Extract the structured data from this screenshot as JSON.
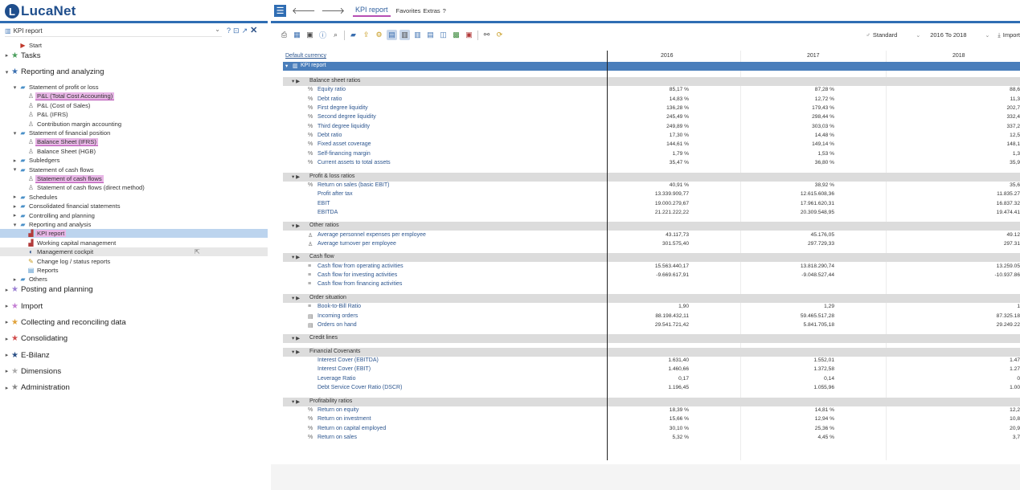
{
  "app": {
    "logo_text": "LucaNet"
  },
  "left": {
    "search_value": "KPI report",
    "tools": {
      "help": "?",
      "filter": "⊡",
      "pin": "↗",
      "close": "✕"
    },
    "tree": [
      {
        "label": "Start",
        "level": 1,
        "icon": "flag",
        "big": false
      },
      {
        "label": "Tasks",
        "level": 0,
        "icon": "star",
        "big": true
      },
      {
        "label": "Reporting and analyzing",
        "level": 0,
        "icon": "star",
        "big": true
      },
      {
        "label": "Statement of profit or loss",
        "level": 1,
        "icon": "folder"
      },
      {
        "label": "P&L (Total Cost Accounting)",
        "level": 2,
        "icon": "doc",
        "highlight": true
      },
      {
        "label": "P&L (Cost of Sales)",
        "level": 2,
        "icon": "doc"
      },
      {
        "label": "P&L (IFRS)",
        "level": 2,
        "icon": "doc"
      },
      {
        "label": "Contribution margin accounting",
        "level": 2,
        "icon": "doc"
      },
      {
        "label": "Statement of financial position",
        "level": 1,
        "icon": "folder"
      },
      {
        "label": "Balance Sheet (IFRS)",
        "level": 2,
        "icon": "doc",
        "highlight": true
      },
      {
        "label": "Balance Sheet (HGB)",
        "level": 2,
        "icon": "doc"
      },
      {
        "label": "Subledgers",
        "level": 1,
        "icon": "folder"
      },
      {
        "label": "Statement of cash flows",
        "level": 1,
        "icon": "folder"
      },
      {
        "label": "Statement of cash flows",
        "level": 2,
        "icon": "doc",
        "highlight": true
      },
      {
        "label": "Statement of cash flows (direct method)",
        "level": 2,
        "icon": "doc"
      },
      {
        "label": "Schedules",
        "level": 1,
        "icon": "folder"
      },
      {
        "label": "Consolidated financial statements",
        "level": 1,
        "icon": "folder"
      },
      {
        "label": "Controlling and planning",
        "level": 1,
        "icon": "folder"
      },
      {
        "label": "Reporting and analysis",
        "level": 1,
        "icon": "folder"
      },
      {
        "label": "KPI report",
        "level": 2,
        "icon": "chart",
        "highlight": true,
        "selected": true
      },
      {
        "label": "Working capital management",
        "level": 2,
        "icon": "chart"
      },
      {
        "label": "Management cockpit",
        "level": 2,
        "icon": "gauge",
        "hover": true
      },
      {
        "label": "Change log / status reports",
        "level": 2,
        "icon": "log"
      },
      {
        "label": "Reports",
        "level": 2,
        "icon": "report"
      },
      {
        "label": "Others",
        "level": 1,
        "icon": "folder"
      },
      {
        "label": "Posting and planning",
        "level": 0,
        "icon": "star",
        "big": true
      },
      {
        "label": "Import",
        "level": 0,
        "icon": "star",
        "big": true
      },
      {
        "label": "Collecting and reconciling data",
        "level": 0,
        "icon": "star",
        "big": true
      },
      {
        "label": "Consolidating",
        "level": 0,
        "icon": "star",
        "big": true
      },
      {
        "label": "E-Bilanz",
        "level": 0,
        "icon": "star",
        "big": true
      },
      {
        "label": "Dimensions",
        "level": 0,
        "icon": "star",
        "big": true
      },
      {
        "label": "Administration",
        "level": 0,
        "icon": "star",
        "big": true
      }
    ]
  },
  "topnav": {
    "tab_label": "KPI report",
    "links": [
      "Favorites",
      "Extras",
      "?"
    ]
  },
  "toolbar_right": {
    "view": "Standard",
    "period": "2016 To 2018",
    "import": "Import"
  },
  "grid": {
    "header_left": "Default currency",
    "columns": [
      "2016",
      "2017",
      "2018"
    ],
    "report_title": "KPI report",
    "rows": [
      {
        "type": "group",
        "label": "Balance sheet ratios"
      },
      {
        "type": "item",
        "icon": "%",
        "label": "Equity ratio",
        "values": [
          "85,17 %",
          "87,28 %",
          "88,6"
        ]
      },
      {
        "type": "item",
        "icon": "%",
        "label": "Debt ratio",
        "values": [
          "14,83 %",
          "12,72 %",
          "11,3"
        ]
      },
      {
        "type": "item",
        "icon": "%",
        "label": "First degree liquidity",
        "values": [
          "136,28 %",
          "179,43 %",
          "202,7"
        ]
      },
      {
        "type": "item",
        "icon": "%",
        "label": "Second degree liquidity",
        "values": [
          "245,49 %",
          "298,44 %",
          "332,4"
        ]
      },
      {
        "type": "item",
        "icon": "%",
        "label": "Third degree liquidity",
        "values": [
          "249,89 %",
          "303,03 %",
          "337,2"
        ]
      },
      {
        "type": "item",
        "icon": "%",
        "label": "Debt ratio",
        "values": [
          "17,30 %",
          "14,48 %",
          "12,5"
        ]
      },
      {
        "type": "item",
        "icon": "%",
        "label": "Fixed asset coverage",
        "values": [
          "144,61 %",
          "149,14 %",
          "148,1"
        ]
      },
      {
        "type": "item",
        "icon": "%",
        "label": "Self-financing margin",
        "values": [
          "1,79 %",
          "1,53 %",
          "1,3"
        ]
      },
      {
        "type": "item",
        "icon": "%",
        "label": "Current assets to total assets",
        "values": [
          "35,47 %",
          "36,80 %",
          "35,9"
        ]
      },
      {
        "type": "gap"
      },
      {
        "type": "group",
        "label": "Profit & loss ratios"
      },
      {
        "type": "item",
        "icon": "%",
        "label": "Return on sales (basic EBIT)",
        "values": [
          "40,91 %",
          "38,92 %",
          "35,6"
        ]
      },
      {
        "type": "item",
        "icon": "",
        "label": "Profit after tax",
        "values": [
          "13.339.909,77",
          "12.615.608,36",
          "11.835.27"
        ]
      },
      {
        "type": "item",
        "icon": "",
        "label": "EBIT",
        "values": [
          "19.000.279,67",
          "17.961.620,31",
          "16.837.32"
        ]
      },
      {
        "type": "item",
        "icon": "",
        "label": "EBITDA",
        "values": [
          "21.221.222,22",
          "20.309.548,95",
          "19.474.41"
        ]
      },
      {
        "type": "gap"
      },
      {
        "type": "group",
        "label": "Other ratios"
      },
      {
        "type": "item",
        "icon": "♙",
        "label": "Average personnel expenses per employee",
        "values": [
          "43.117,73",
          "45.176,05",
          "49.12"
        ]
      },
      {
        "type": "item",
        "icon": "♙",
        "label": "Average turnover per employee",
        "values": [
          "301.575,40",
          "297.729,33",
          "297.31"
        ]
      },
      {
        "type": "gap"
      },
      {
        "type": "group",
        "label": "Cash flow"
      },
      {
        "type": "item",
        "icon": "≡",
        "label": "Cash flow from operating activities",
        "values": [
          "15.563.440,17",
          "13.818.290,74",
          "13.259.05"
        ]
      },
      {
        "type": "item",
        "icon": "≡",
        "label": "Cash flow for investing activities",
        "values": [
          "-9.669.617,91",
          "-9.048.527,44",
          "-10.937.86"
        ]
      },
      {
        "type": "item",
        "icon": "≡",
        "label": "Cash flow from financing activities",
        "values": [
          "",
          "",
          ""
        ]
      },
      {
        "type": "gap"
      },
      {
        "type": "group",
        "label": "Order situation"
      },
      {
        "type": "item",
        "icon": "≡",
        "label": "Book-to-Bill Ratio",
        "values": [
          "1,90",
          "1,29",
          "1"
        ]
      },
      {
        "type": "item",
        "icon": "▤",
        "label": "Incoming orders",
        "values": [
          "88.198.432,11",
          "59.465.517,28",
          "87.325.18"
        ]
      },
      {
        "type": "item",
        "icon": "▤",
        "label": "Orders on hand",
        "values": [
          "29.541.721,42",
          "5.841.705,18",
          "29.249.22"
        ]
      },
      {
        "type": "gap"
      },
      {
        "type": "group",
        "label": "Credit lines"
      },
      {
        "type": "gap"
      },
      {
        "type": "group",
        "label": "Financial Covenants"
      },
      {
        "type": "item",
        "icon": "",
        "label": "Interest Cover (EBITDA)",
        "values": [
          "1.631,40",
          "1.552,01",
          "1.47"
        ]
      },
      {
        "type": "item",
        "icon": "",
        "label": "Interest Cover (EBIT)",
        "values": [
          "1.460,66",
          "1.372,58",
          "1.27"
        ]
      },
      {
        "type": "item",
        "icon": "",
        "label": "Leverage Ratio",
        "values": [
          "0,17",
          "0,14",
          "0"
        ]
      },
      {
        "type": "item",
        "icon": "",
        "label": "Debt Service Cover Ratio (DSCR)",
        "values": [
          "1.196,45",
          "1.055,96",
          "1.00"
        ]
      },
      {
        "type": "gap"
      },
      {
        "type": "group",
        "label": "Profitability ratios"
      },
      {
        "type": "item",
        "icon": "%",
        "label": "Return on equity",
        "values": [
          "18,39 %",
          "14,81 %",
          "12,2"
        ]
      },
      {
        "type": "item",
        "icon": "%",
        "label": "Return on investment",
        "values": [
          "15,66 %",
          "12,94 %",
          "10,8"
        ]
      },
      {
        "type": "item",
        "icon": "%",
        "label": "Return on capital employed",
        "values": [
          "30,10 %",
          "25,36 %",
          "20,9"
        ]
      },
      {
        "type": "item",
        "icon": "%",
        "label": "Return on sales",
        "values": [
          "5,32 %",
          "4,45 %",
          "3,7"
        ]
      }
    ]
  },
  "colors": {
    "brand": "#1f4e8c",
    "accent_bar": "#2f6db3",
    "highlight": "#e8b6e6",
    "selected": "#bcd4ee"
  }
}
